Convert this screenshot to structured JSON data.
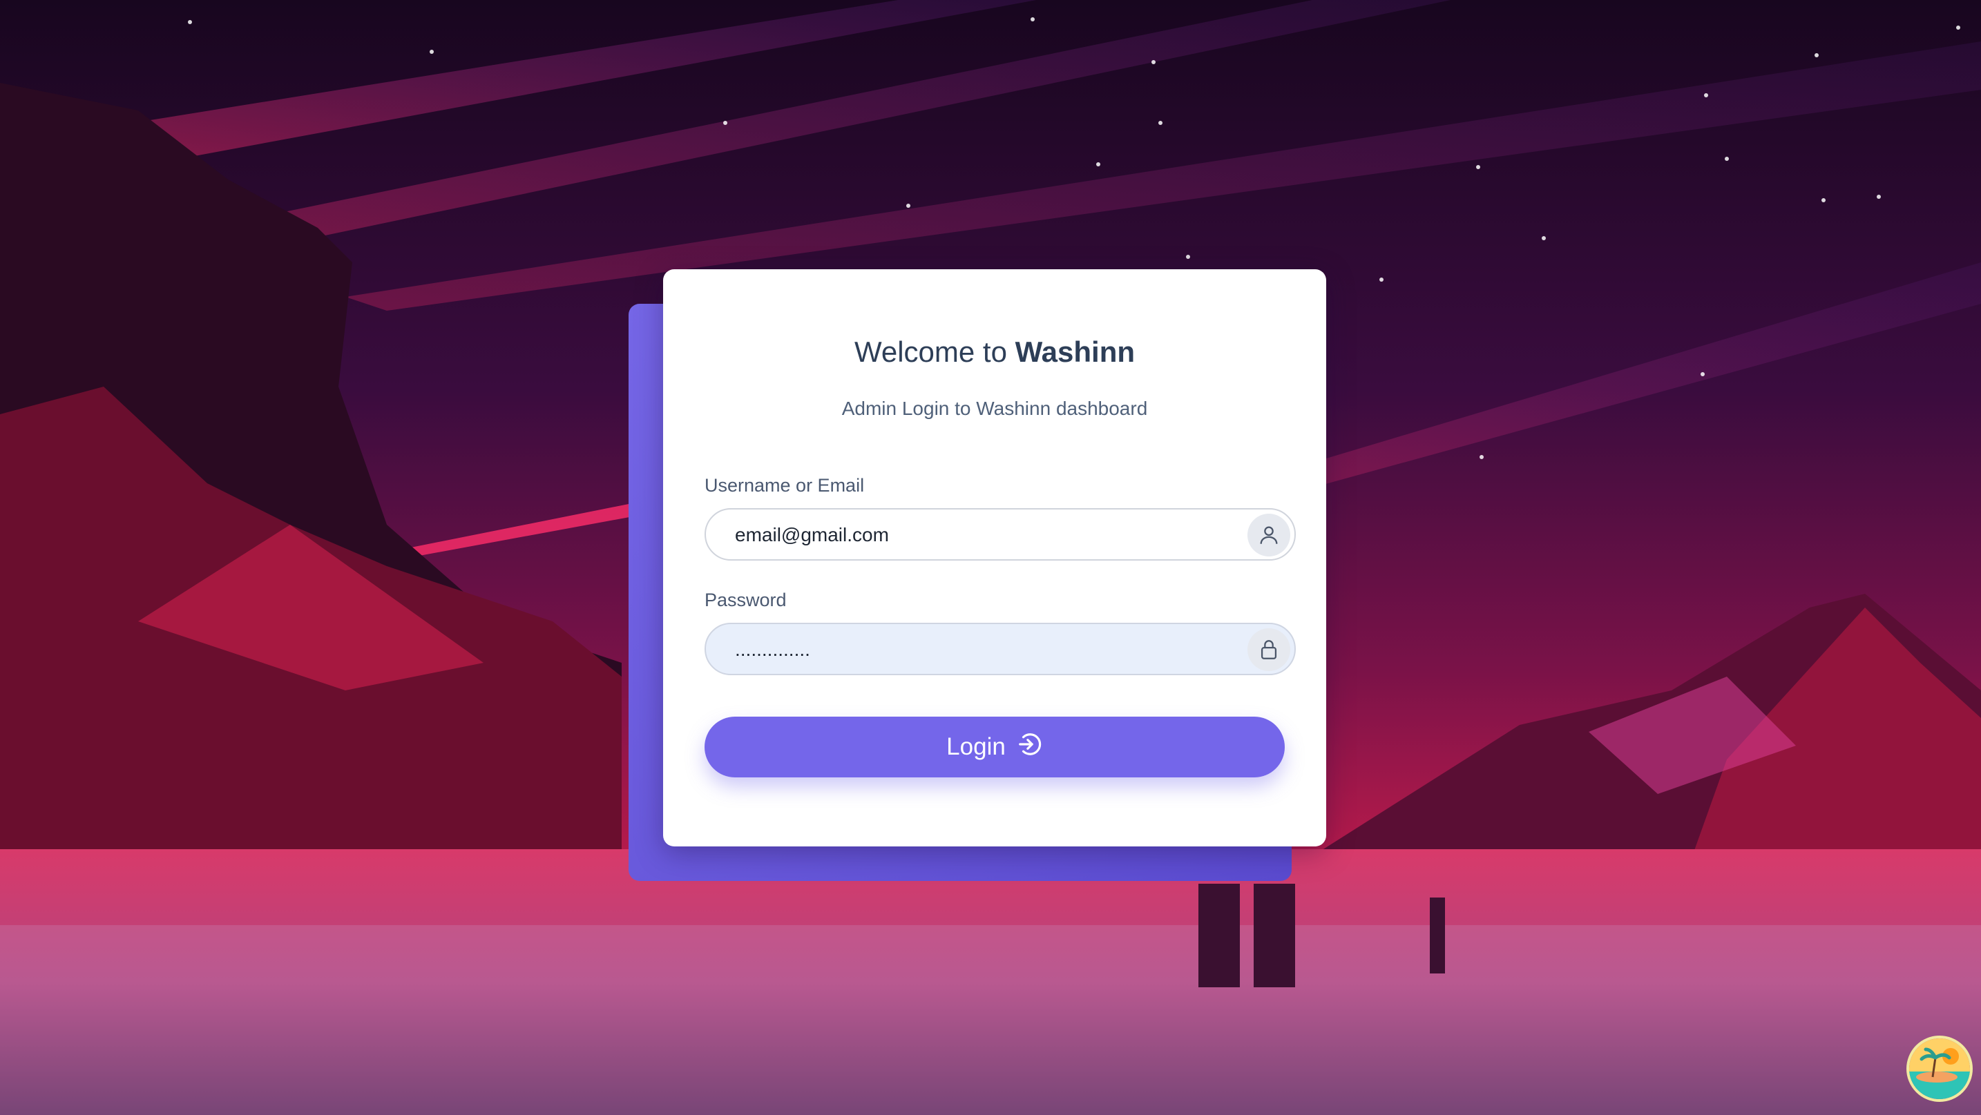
{
  "login_card": {
    "title_prefix": "Welcome to ",
    "title_brand": "Washinn",
    "subtitle": "Admin Login to Washinn dashboard",
    "username_label": "Username or Email",
    "username_value": "email@gmail.com",
    "password_label": "Password",
    "password_mask": "..............",
    "login_button_label": "Login"
  },
  "icons": {
    "username": "user-icon",
    "password": "lock-icon",
    "login": "sign-in-icon",
    "corner_badge": "beach-island-icon"
  },
  "colors": {
    "accent": "#7466ea",
    "card_shadow": "#5b4bd0",
    "title_text": "#2d3e57"
  }
}
